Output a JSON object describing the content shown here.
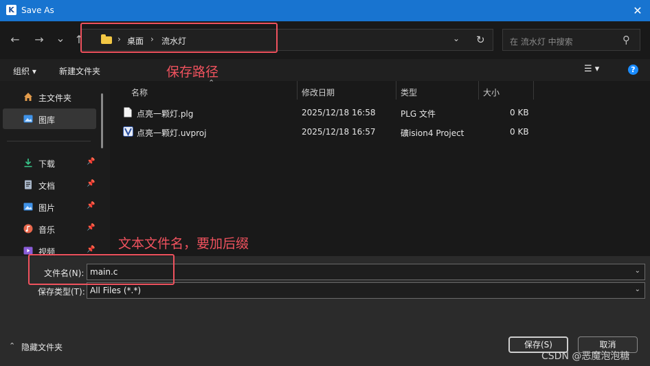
{
  "window": {
    "title": "Save As",
    "close_glyph": "✕",
    "app_icon_glyph": "K"
  },
  "nav": {
    "back_glyph": "←",
    "forward_glyph": "→",
    "recent_glyph": "⌄",
    "up_glyph": "↑",
    "history_glyph": "⌄",
    "refresh_glyph": "↻"
  },
  "address": {
    "sep_glyph": "›",
    "crumbs": [
      "桌面",
      "流水灯"
    ]
  },
  "search": {
    "placeholder": "在 流水灯 中搜索",
    "icon_glyph": "⚲"
  },
  "toolbar": {
    "organize": "组织 ▾",
    "new_folder": "新建文件夹",
    "view_glyph": "☰ ▾",
    "help_glyph": "?"
  },
  "sidebar": {
    "pin_glyph": "📌",
    "items": [
      {
        "label": "主文件夹",
        "icon": "home-icon"
      },
      {
        "label": "图库",
        "icon": "gallery-icon",
        "selected": true
      },
      {
        "label": "下载",
        "icon": "download-icon",
        "pinned": true
      },
      {
        "label": "文档",
        "icon": "document-icon",
        "pinned": true
      },
      {
        "label": "图片",
        "icon": "picture-icon",
        "pinned": true
      },
      {
        "label": "音乐",
        "icon": "music-icon",
        "pinned": true
      },
      {
        "label": "视频",
        "icon": "video-icon",
        "pinned": true
      }
    ]
  },
  "file_list": {
    "sort_glyph": "⌃",
    "columns": [
      "名称",
      "修改日期",
      "类型",
      "大小"
    ],
    "rows": [
      {
        "name": "点亮一颗灯.plg",
        "date": "2025/12/18 16:58",
        "type": "PLG 文件",
        "size": "0 KB",
        "icon": "file-icon"
      },
      {
        "name": "点亮一颗灯.uvproj",
        "date": "2025/12/18 16:57",
        "type": "礦ision4 Project",
        "size": "0 KB",
        "icon": "keil-project-icon"
      }
    ]
  },
  "form": {
    "filename_label": "文件名(N):",
    "filename_value": "main.c",
    "type_label": "保存类型(T):",
    "type_value": "All Files (*.*)",
    "dropdown_glyph": "⌄"
  },
  "footer": {
    "hide_folders": "隐藏文件夹",
    "hide_glyph": "⌃",
    "save": "保存(S)",
    "cancel": "取消"
  },
  "annotations": {
    "path_note": "保存路径",
    "filename_note": "文本文件名，要加后缀"
  },
  "watermark": "CSDN @恶魔泡泡糖",
  "colors": {
    "accent": "#1874d0",
    "annotation": "#f0525e",
    "folder": "#f2c744"
  }
}
